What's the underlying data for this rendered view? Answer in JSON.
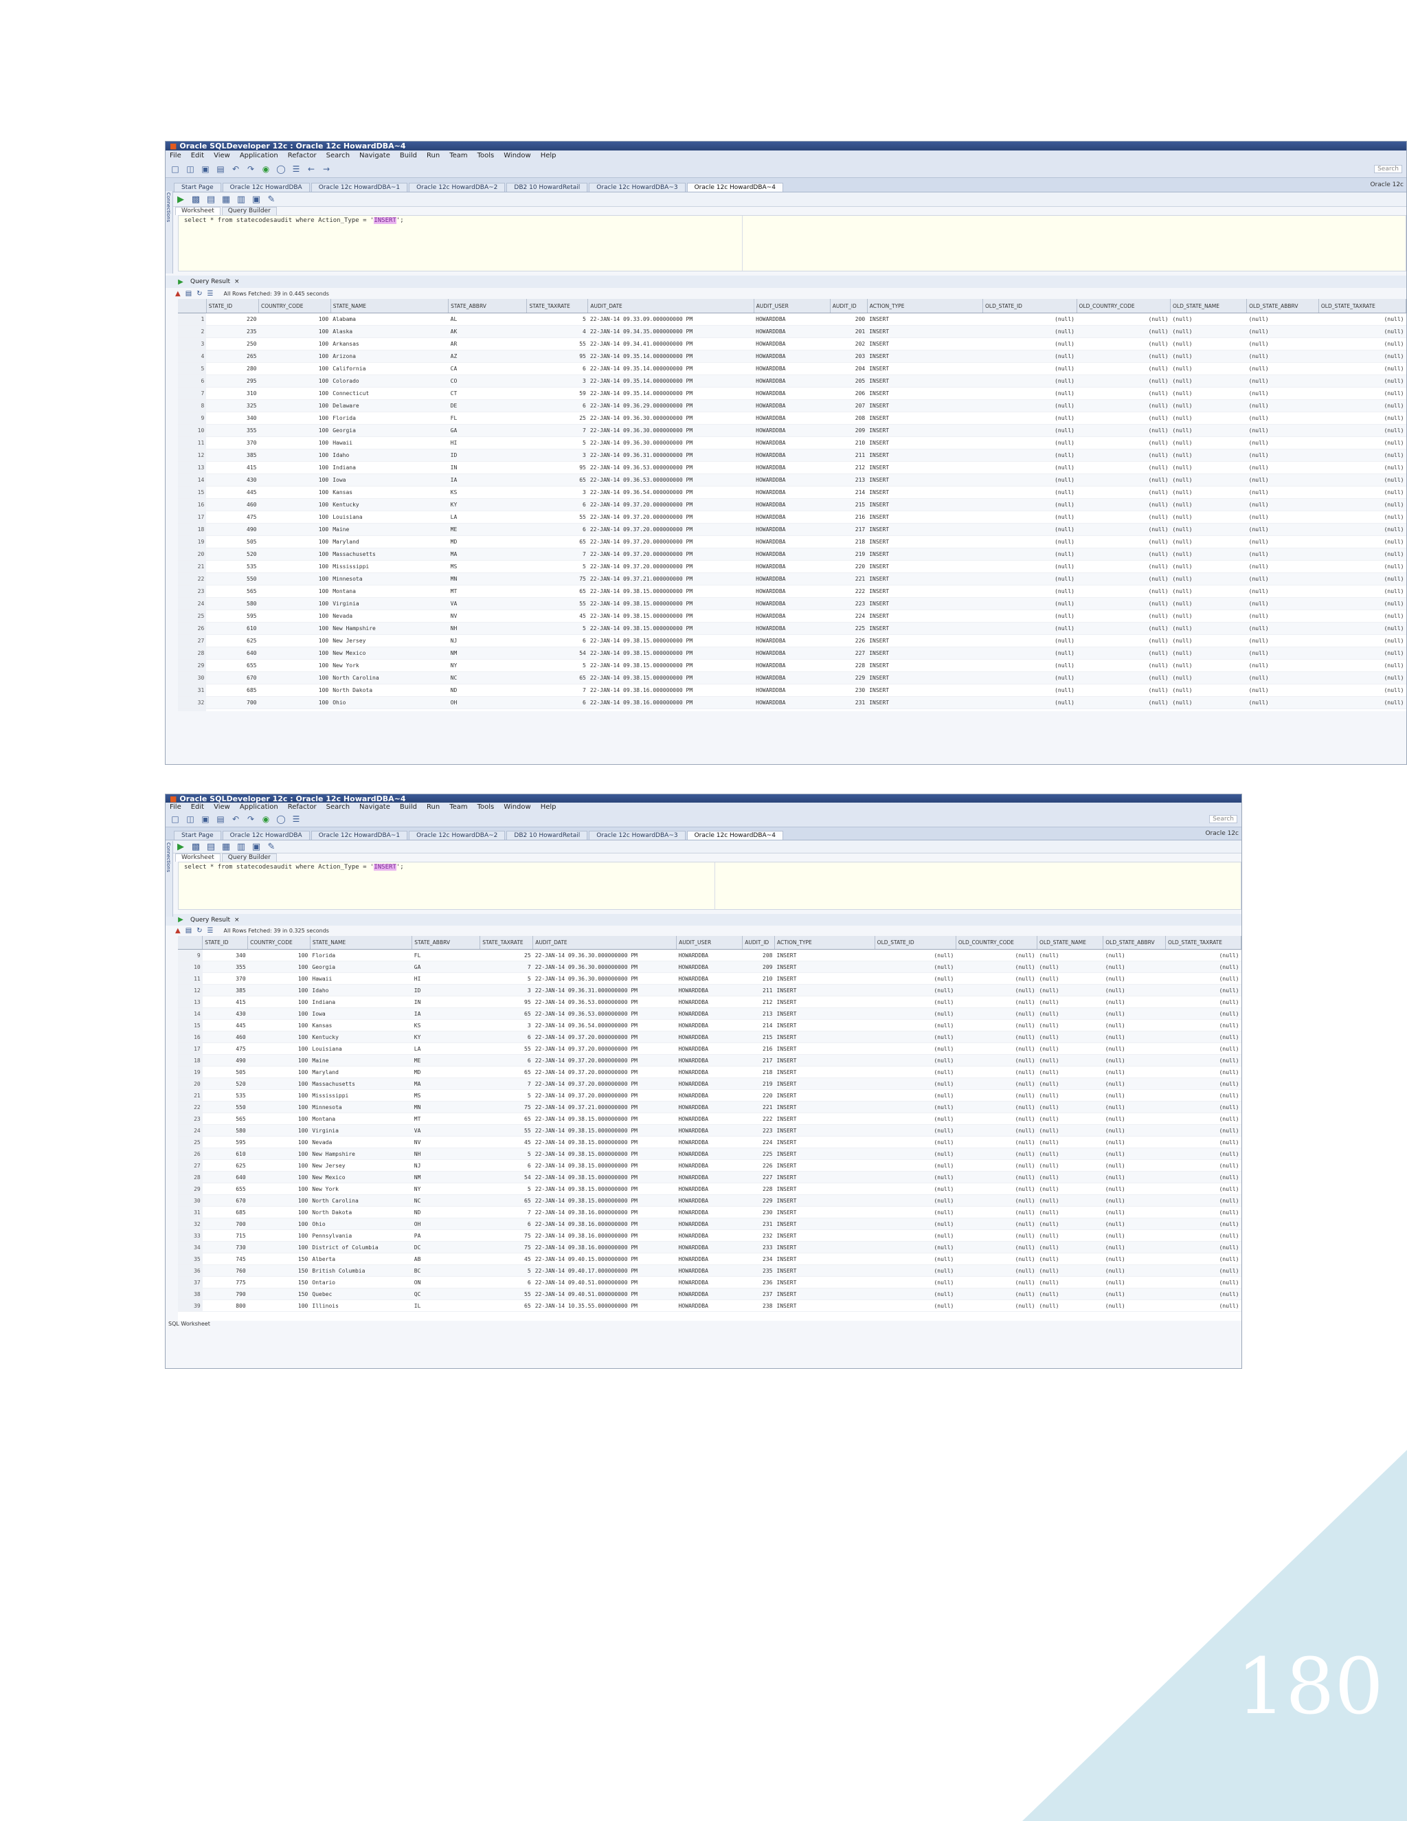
{
  "page_number": "180",
  "window": {
    "title": "Oracle SQLDeveloper 12c : Oracle 12c HowardDBA~4",
    "menus": [
      "File",
      "Edit",
      "View",
      "Application",
      "Refactor",
      "Search",
      "Navigate",
      "Build",
      "Run",
      "Team",
      "Tools",
      "Window",
      "Help"
    ],
    "search_placeholder": "Search",
    "tabs": [
      "Start Page",
      "Oracle 12c HowardDBA",
      "Oracle 12c HowardDBA~1",
      "Oracle 12c HowardDBA~2",
      "DB2 10 HowardRetail",
      "Oracle 12c HowardDBA~3",
      "Oracle 12c HowardDBA~4"
    ],
    "active_tab": 6,
    "connection": "Oracle 12c",
    "side_label": "Connections",
    "subtabs": [
      "Worksheet",
      "Query Builder"
    ],
    "query_prefix": "select * from statecodesaudit where Action_Type = '",
    "query_literal": "INSERT",
    "query_suffix": "';",
    "result_tab": "Query Result",
    "fetch_msg_1": "All Rows Fetched: 39 in 0.445 seconds",
    "fetch_msg_2": "All Rows Fetched: 39 in 0.325 seconds",
    "status": "SQL Worksheet"
  },
  "columns": [
    "STATE_ID",
    "COUNTRY_CODE",
    "STATE_NAME",
    "STATE_ABBRV",
    "STATE_TAXRATE",
    "AUDIT_DATE",
    "AUDIT_USER",
    "AUDIT_ID",
    "ACTION_TYPE",
    "OLD_STATE_ID",
    "OLD_COUNTRY_CODE",
    "OLD_STATE_NAME",
    "OLD_STATE_ABBRV",
    "OLD_STATE_TAXRATE"
  ],
  "rows": [
    [
      "1",
      "220",
      "100",
      "Alabama",
      "AL",
      "5",
      "22-JAN-14 09.33.09.000000000 PM",
      "HOWARDDBA",
      "200",
      "INSERT",
      "(null)",
      "(null)",
      "(null)",
      "(null)",
      "(null)"
    ],
    [
      "2",
      "235",
      "100",
      "Alaska",
      "AK",
      "4",
      "22-JAN-14 09.34.35.000000000 PM",
      "HOWARDDBA",
      "201",
      "INSERT",
      "(null)",
      "(null)",
      "(null)",
      "(null)",
      "(null)"
    ],
    [
      "3",
      "250",
      "100",
      "Arkansas",
      "AR",
      "55",
      "22-JAN-14 09.34.41.000000000 PM",
      "HOWARDDBA",
      "202",
      "INSERT",
      "(null)",
      "(null)",
      "(null)",
      "(null)",
      "(null)"
    ],
    [
      "4",
      "265",
      "100",
      "Arizona",
      "AZ",
      "95",
      "22-JAN-14 09.35.14.000000000 PM",
      "HOWARDDBA",
      "203",
      "INSERT",
      "(null)",
      "(null)",
      "(null)",
      "(null)",
      "(null)"
    ],
    [
      "5",
      "280",
      "100",
      "California",
      "CA",
      "6",
      "22-JAN-14 09.35.14.000000000 PM",
      "HOWARDDBA",
      "204",
      "INSERT",
      "(null)",
      "(null)",
      "(null)",
      "(null)",
      "(null)"
    ],
    [
      "6",
      "295",
      "100",
      "Colorado",
      "CO",
      "3",
      "22-JAN-14 09.35.14.000000000 PM",
      "HOWARDDBA",
      "205",
      "INSERT",
      "(null)",
      "(null)",
      "(null)",
      "(null)",
      "(null)"
    ],
    [
      "7",
      "310",
      "100",
      "Connecticut",
      "CT",
      "59",
      "22-JAN-14 09.35.14.000000000 PM",
      "HOWARDDBA",
      "206",
      "INSERT",
      "(null)",
      "(null)",
      "(null)",
      "(null)",
      "(null)"
    ],
    [
      "8",
      "325",
      "100",
      "Delaware",
      "DE",
      "6",
      "22-JAN-14 09.36.29.000000000 PM",
      "HOWARDDBA",
      "207",
      "INSERT",
      "(null)",
      "(null)",
      "(null)",
      "(null)",
      "(null)"
    ],
    [
      "9",
      "340",
      "100",
      "Florida",
      "FL",
      "25",
      "22-JAN-14 09.36.30.000000000 PM",
      "HOWARDDBA",
      "208",
      "INSERT",
      "(null)",
      "(null)",
      "(null)",
      "(null)",
      "(null)"
    ],
    [
      "10",
      "355",
      "100",
      "Georgia",
      "GA",
      "7",
      "22-JAN-14 09.36.30.000000000 PM",
      "HOWARDDBA",
      "209",
      "INSERT",
      "(null)",
      "(null)",
      "(null)",
      "(null)",
      "(null)"
    ],
    [
      "11",
      "370",
      "100",
      "Hawaii",
      "HI",
      "5",
      "22-JAN-14 09.36.30.000000000 PM",
      "HOWARDDBA",
      "210",
      "INSERT",
      "(null)",
      "(null)",
      "(null)",
      "(null)",
      "(null)"
    ],
    [
      "12",
      "385",
      "100",
      "Idaho",
      "ID",
      "3",
      "22-JAN-14 09.36.31.000000000 PM",
      "HOWARDDBA",
      "211",
      "INSERT",
      "(null)",
      "(null)",
      "(null)",
      "(null)",
      "(null)"
    ],
    [
      "13",
      "415",
      "100",
      "Indiana",
      "IN",
      "95",
      "22-JAN-14 09.36.53.000000000 PM",
      "HOWARDDBA",
      "212",
      "INSERT",
      "(null)",
      "(null)",
      "(null)",
      "(null)",
      "(null)"
    ],
    [
      "14",
      "430",
      "100",
      "Iowa",
      "IA",
      "65",
      "22-JAN-14 09.36.53.000000000 PM",
      "HOWARDDBA",
      "213",
      "INSERT",
      "(null)",
      "(null)",
      "(null)",
      "(null)",
      "(null)"
    ],
    [
      "15",
      "445",
      "100",
      "Kansas",
      "KS",
      "3",
      "22-JAN-14 09.36.54.000000000 PM",
      "HOWARDDBA",
      "214",
      "INSERT",
      "(null)",
      "(null)",
      "(null)",
      "(null)",
      "(null)"
    ],
    [
      "16",
      "460",
      "100",
      "Kentucky",
      "KY",
      "6",
      "22-JAN-14 09.37.20.000000000 PM",
      "HOWARDDBA",
      "215",
      "INSERT",
      "(null)",
      "(null)",
      "(null)",
      "(null)",
      "(null)"
    ],
    [
      "17",
      "475",
      "100",
      "Louisiana",
      "LA",
      "55",
      "22-JAN-14 09.37.20.000000000 PM",
      "HOWARDDBA",
      "216",
      "INSERT",
      "(null)",
      "(null)",
      "(null)",
      "(null)",
      "(null)"
    ],
    [
      "18",
      "490",
      "100",
      "Maine",
      "ME",
      "6",
      "22-JAN-14 09.37.20.000000000 PM",
      "HOWARDDBA",
      "217",
      "INSERT",
      "(null)",
      "(null)",
      "(null)",
      "(null)",
      "(null)"
    ],
    [
      "19",
      "505",
      "100",
      "Maryland",
      "MD",
      "65",
      "22-JAN-14 09.37.20.000000000 PM",
      "HOWARDDBA",
      "218",
      "INSERT",
      "(null)",
      "(null)",
      "(null)",
      "(null)",
      "(null)"
    ],
    [
      "20",
      "520",
      "100",
      "Massachusetts",
      "MA",
      "7",
      "22-JAN-14 09.37.20.000000000 PM",
      "HOWARDDBA",
      "219",
      "INSERT",
      "(null)",
      "(null)",
      "(null)",
      "(null)",
      "(null)"
    ],
    [
      "21",
      "535",
      "100",
      "Mississippi",
      "MS",
      "5",
      "22-JAN-14 09.37.20.000000000 PM",
      "HOWARDDBA",
      "220",
      "INSERT",
      "(null)",
      "(null)",
      "(null)",
      "(null)",
      "(null)"
    ],
    [
      "22",
      "550",
      "100",
      "Minnesota",
      "MN",
      "75",
      "22-JAN-14 09.37.21.000000000 PM",
      "HOWARDDBA",
      "221",
      "INSERT",
      "(null)",
      "(null)",
      "(null)",
      "(null)",
      "(null)"
    ],
    [
      "23",
      "565",
      "100",
      "Montana",
      "MT",
      "65",
      "22-JAN-14 09.38.15.000000000 PM",
      "HOWARDDBA",
      "222",
      "INSERT",
      "(null)",
      "(null)",
      "(null)",
      "(null)",
      "(null)"
    ],
    [
      "24",
      "580",
      "100",
      "Virginia",
      "VA",
      "55",
      "22-JAN-14 09.38.15.000000000 PM",
      "HOWARDDBA",
      "223",
      "INSERT",
      "(null)",
      "(null)",
      "(null)",
      "(null)",
      "(null)"
    ],
    [
      "25",
      "595",
      "100",
      "Nevada",
      "NV",
      "45",
      "22-JAN-14 09.38.15.000000000 PM",
      "HOWARDDBA",
      "224",
      "INSERT",
      "(null)",
      "(null)",
      "(null)",
      "(null)",
      "(null)"
    ],
    [
      "26",
      "610",
      "100",
      "New Hampshire",
      "NH",
      "5",
      "22-JAN-14 09.38.15.000000000 PM",
      "HOWARDDBA",
      "225",
      "INSERT",
      "(null)",
      "(null)",
      "(null)",
      "(null)",
      "(null)"
    ],
    [
      "27",
      "625",
      "100",
      "New Jersey",
      "NJ",
      "6",
      "22-JAN-14 09.38.15.000000000 PM",
      "HOWARDDBA",
      "226",
      "INSERT",
      "(null)",
      "(null)",
      "(null)",
      "(null)",
      "(null)"
    ],
    [
      "28",
      "640",
      "100",
      "New Mexico",
      "NM",
      "54",
      "22-JAN-14 09.38.15.000000000 PM",
      "HOWARDDBA",
      "227",
      "INSERT",
      "(null)",
      "(null)",
      "(null)",
      "(null)",
      "(null)"
    ],
    [
      "29",
      "655",
      "100",
      "New York",
      "NY",
      "5",
      "22-JAN-14 09.38.15.000000000 PM",
      "HOWARDDBA",
      "228",
      "INSERT",
      "(null)",
      "(null)",
      "(null)",
      "(null)",
      "(null)"
    ],
    [
      "30",
      "670",
      "100",
      "North Carolina",
      "NC",
      "65",
      "22-JAN-14 09.38.15.000000000 PM",
      "HOWARDDBA",
      "229",
      "INSERT",
      "(null)",
      "(null)",
      "(null)",
      "(null)",
      "(null)"
    ],
    [
      "31",
      "685",
      "100",
      "North Dakota",
      "ND",
      "7",
      "22-JAN-14 09.38.16.000000000 PM",
      "HOWARDDBA",
      "230",
      "INSERT",
      "(null)",
      "(null)",
      "(null)",
      "(null)",
      "(null)"
    ],
    [
      "32",
      "700",
      "100",
      "Ohio",
      "OH",
      "6",
      "22-JAN-14 09.38.16.000000000 PM",
      "HOWARDDBA",
      "231",
      "INSERT",
      "(null)",
      "(null)",
      "(null)",
      "(null)",
      "(null)"
    ],
    [
      "33",
      "715",
      "100",
      "Pennsylvania",
      "PA",
      "75",
      "22-JAN-14 09.38.16.000000000 PM",
      "HOWARDDBA",
      "232",
      "INSERT",
      "(null)",
      "(null)",
      "(null)",
      "(null)",
      "(null)"
    ],
    [
      "34",
      "730",
      "100",
      "District of Columbia",
      "DC",
      "75",
      "22-JAN-14 09.38.16.000000000 PM",
      "HOWARDDBA",
      "233",
      "INSERT",
      "(null)",
      "(null)",
      "(null)",
      "(null)",
      "(null)"
    ],
    [
      "35",
      "745",
      "150",
      "Alberta",
      "AB",
      "45",
      "22-JAN-14 09.40.15.000000000 PM",
      "HOWARDDBA",
      "234",
      "INSERT",
      "(null)",
      "(null)",
      "(null)",
      "(null)",
      "(null)"
    ],
    [
      "36",
      "760",
      "150",
      "British Columbia",
      "BC",
      "5",
      "22-JAN-14 09.40.17.000000000 PM",
      "HOWARDDBA",
      "235",
      "INSERT",
      "(null)",
      "(null)",
      "(null)",
      "(null)",
      "(null)"
    ],
    [
      "37",
      "775",
      "150",
      "Ontario",
      "ON",
      "6",
      "22-JAN-14 09.40.51.000000000 PM",
      "HOWARDDBA",
      "236",
      "INSERT",
      "(null)",
      "(null)",
      "(null)",
      "(null)",
      "(null)"
    ],
    [
      "38",
      "790",
      "150",
      "Quebec",
      "QC",
      "55",
      "22-JAN-14 09.40.51.000000000 PM",
      "HOWARDDBA",
      "237",
      "INSERT",
      "(null)",
      "(null)",
      "(null)",
      "(null)",
      "(null)"
    ],
    [
      "39",
      "800",
      "100",
      "Illinois",
      "IL",
      "65",
      "22-JAN-14 10.35.55.000000000 PM",
      "HOWARDDBA",
      "238",
      "INSERT",
      "(null)",
      "(null)",
      "(null)",
      "(null)",
      "(null)"
    ]
  ]
}
